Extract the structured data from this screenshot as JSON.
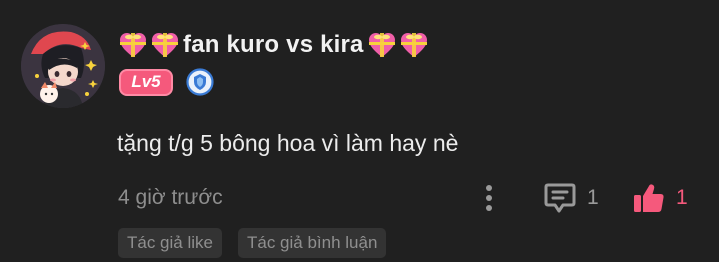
{
  "comment": {
    "username": "fan kuro vs kira",
    "level": "Lv5",
    "text": "tặng t/g 5 bông hoa vì làm hay nè",
    "timestamp": "4 giờ trước",
    "reply_count": "1",
    "like_count": "1",
    "tags": [
      "Tác giả like",
      "Tác giả bình luận"
    ]
  },
  "icons": {
    "name_decorations": [
      "gift-heart-icon",
      "gift-heart-icon",
      "gift-heart-icon",
      "gift-heart-icon"
    ],
    "more": "more-vertical-icon",
    "reply": "comment-bubble-icon",
    "like": "thumbs-up-icon",
    "rank": "shield-icon"
  },
  "colors": {
    "background": "#202020",
    "accent_pink": "#f5597c",
    "rank_blue": "#3a7bd5",
    "muted_text": "#8e8e8e",
    "tag_bg": "#333333"
  }
}
